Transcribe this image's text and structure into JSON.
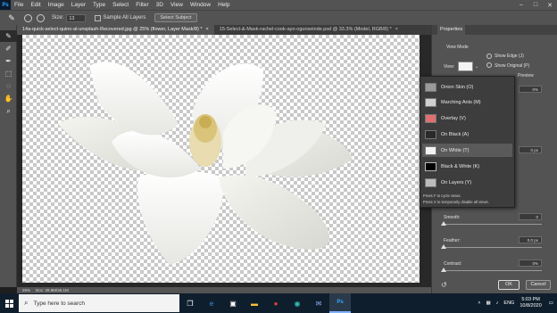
{
  "app": {
    "name": "Ps"
  },
  "menu": [
    "File",
    "Edit",
    "Image",
    "Layer",
    "Type",
    "Select",
    "Filter",
    "3D",
    "View",
    "Window",
    "Help"
  ],
  "window_controls": [
    "–",
    "□",
    "✕"
  ],
  "options_bar": {
    "size_label": "Size:",
    "size_value": "13",
    "sample_all_layers_label": "Sample All Layers",
    "select_subject_label": "Select Subject"
  },
  "tabs": [
    {
      "label": "14a-quick-select-quino-al-unsplash-Recovered.jpg @ 25% (flower, Layer Mask/8) *",
      "close": "×"
    },
    {
      "label": "15-Select-&-Mask-rachel-cook-ayo-ogunseinde.psd @ 33.3% (Model, RGB/8) *",
      "close": "×"
    }
  ],
  "status": {
    "zoom": "25%",
    "doc": "Doc: 28.8M/46.1M"
  },
  "properties": {
    "title": "Properties",
    "view_mode_label": "View Mode",
    "view_label": "View:",
    "show_edge_label": "Show Edge (J)",
    "show_original_label": "Show Original (P)",
    "preview_label": "Preview",
    "field1_value": "0%",
    "field2_value": "0 px",
    "smooth_label": "Smooth:",
    "smooth_value": "0",
    "feather_label": "Feather:",
    "feather_value": "0.0 px",
    "contrast_label": "Contrast:",
    "contrast_value": "0%",
    "ok_label": "OK",
    "cancel_label": "Cancel"
  },
  "view_menu": {
    "items": [
      {
        "label": "Onion Skin (O)",
        "thumb": "onion"
      },
      {
        "label": "Marching Ants (M)",
        "thumb": "ants"
      },
      {
        "label": "Overlay (V)",
        "thumb": "overlay"
      },
      {
        "label": "On Black (A)",
        "thumb": "black"
      },
      {
        "label": "On White (T)",
        "thumb": "white"
      },
      {
        "label": "Black & White (K)",
        "thumb": "bw"
      },
      {
        "label": "On Layers (Y)",
        "thumb": "layers"
      }
    ],
    "selected_index": 4,
    "note1": "Press F to cycle views.",
    "note2": "Press X to temporarily disable all views."
  },
  "taskbar": {
    "search_placeholder": "Type here to search",
    "apps": [
      "task-view-icon",
      "edge-icon",
      "store-icon",
      "explorer-icon",
      "chrome-icon",
      "edge-new-icon",
      "mail-icon",
      "photoshop-icon"
    ],
    "language": "ENG",
    "time": "5:03 PM",
    "date": "10/8/2020"
  },
  "colors": {
    "accent": "#31a8ff",
    "panel": "#535353",
    "dark": "#3d3d3d"
  }
}
